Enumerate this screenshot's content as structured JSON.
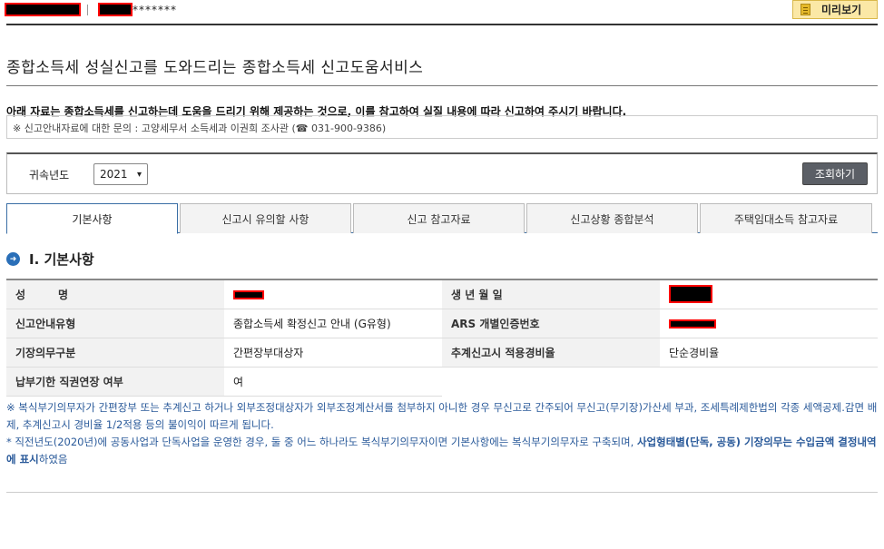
{
  "topbar": {
    "stars": "*******",
    "preview_label": "미리보기"
  },
  "page": {
    "title": "종합소득세 성실신고를 도와드리는 종합소득세 신고도움서비스",
    "notice": "아래 자료는 종합소득세를 신고하는데 도움을 드리기 위해 제공하는 것으로, 이를 참고하여 실질 내용에 따라 신고하여 주시기 바랍니다.",
    "inquiry": "※ 신고안내자료에 대한 문의 : 고양세무서 소득세과 이권희 조사관 (☎ 031-900-9386)"
  },
  "query": {
    "year_label": "귀속년도",
    "year_value": "2021",
    "search_label": "조회하기"
  },
  "tabs": [
    {
      "label": "기본사항"
    },
    {
      "label": "신고시 유의할 사항"
    },
    {
      "label": "신고 참고자료"
    },
    {
      "label": "신고상황 종합분석"
    },
    {
      "label": "주택임대소득 참고자료"
    }
  ],
  "section": {
    "title": "Ⅰ. 기본사항"
  },
  "table": {
    "name_label": "성　　　명",
    "birth_label": "생 년 월 일",
    "guide_type_label": "신고안내유형",
    "guide_type_value": "종합소득세 확정신고 안내 (G유형)",
    "ars_label": "ARS 개별인증번호",
    "bookkeeping_label": "기장의무구분",
    "bookkeeping_value": "간편장부대상자",
    "expense_rate_label": "추계신고시 적용경비율",
    "expense_rate_value": "단순경비율",
    "extension_label": "납부기한 직권연장 여부",
    "extension_value": "여"
  },
  "footnotes": {
    "note1": "※ 복식부기의무자가 간편장부 또는 추계신고 하거나 외부조정대상자가 외부조정계산서를 첨부하지 아니한 경우 무신고로 간주되어 무신고(무기장)가산세 부과, 조세특례제한법의 각종 세액공제.감면 배제, 추계신고시 경비율 1/2적용 등의 불이익이 따르게 됩니다.",
    "note2_plain": "* 직전년도(2020년)에 공동사업과 단독사업을 운영한 경우, 둘 중 어느 하나라도 복식부기의무자이면 기본사항에는 복식부기의무자로 구축되며, ",
    "note2_bold": "사업형태별(단독, 공동) 기장의무는 수입금액 결정내역에 표시",
    "note2_tail": "하였음"
  }
}
